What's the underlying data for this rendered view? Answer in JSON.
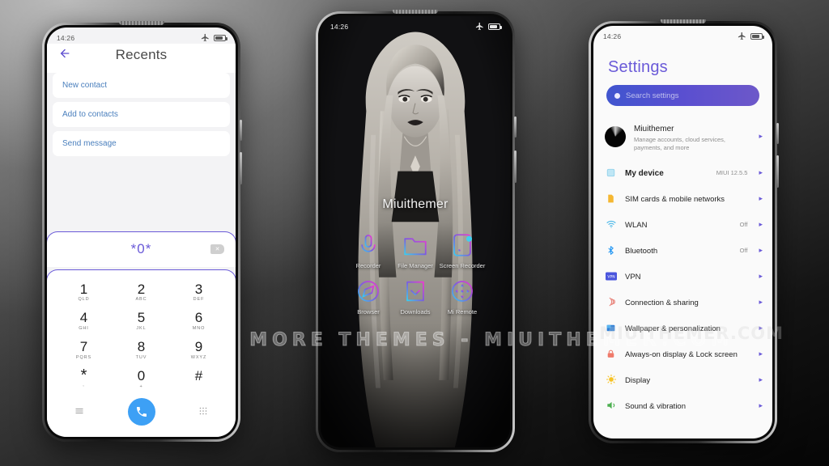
{
  "background": {
    "gradient_from": "#8e8e8e",
    "gradient_to": "#050505"
  },
  "watermark": {
    "main": "VISIT  FOR  MORE  THEMES  -  MIUITHEMER.COM",
    "overlay": "MIUITHEMER.COM"
  },
  "phones": {
    "dialer": {
      "status": {
        "time": "14:26",
        "airplane_icon": "airplane-icon",
        "battery_icon": "battery-icon"
      },
      "header": {
        "back_icon": "back-arrow-icon",
        "title": "Recents"
      },
      "menu": [
        {
          "label": "New contact"
        },
        {
          "label": "Add to contacts"
        },
        {
          "label": "Send message"
        }
      ],
      "number_field": {
        "value": "*0*",
        "backspace_icon": "backspace-icon"
      },
      "keys": [
        {
          "digit": "1",
          "letters": "QLD"
        },
        {
          "digit": "2",
          "letters": "ABC"
        },
        {
          "digit": "3",
          "letters": "DEF"
        },
        {
          "digit": "4",
          "letters": "GHI"
        },
        {
          "digit": "5",
          "letters": "JKL"
        },
        {
          "digit": "6",
          "letters": "MNO"
        },
        {
          "digit": "7",
          "letters": "PQRS"
        },
        {
          "digit": "8",
          "letters": "TUV"
        },
        {
          "digit": "9",
          "letters": "WXYZ"
        },
        {
          "digit": "*",
          "letters": ","
        },
        {
          "digit": "0",
          "letters": "+"
        },
        {
          "digit": "#",
          "letters": ""
        }
      ],
      "bottom": {
        "list_icon": "list-icon",
        "call_icon": "call-icon",
        "keypad_icon": "keypad-icon",
        "call_button_color": "#3da0f5"
      },
      "accent_color": "#6a5ad8",
      "link_color": "#4a7fbd"
    },
    "home": {
      "status": {
        "time": "14:26",
        "airplane_icon": "airplane-icon",
        "battery_icon": "battery-icon"
      },
      "title": "Miuithemer",
      "apps": [
        {
          "label": "Recorder",
          "icon": "microphone-icon"
        },
        {
          "label": "File Manager",
          "icon": "folder-icon"
        },
        {
          "label": "Screen Recorder",
          "icon": "screen-recorder-icon"
        },
        {
          "label": "Browser",
          "icon": "compass-icon"
        },
        {
          "label": "Downloads",
          "icon": "download-icon"
        },
        {
          "label": "Mi Remote",
          "icon": "remote-icon"
        }
      ],
      "icon_gradient": {
        "from": "#3fd0f0",
        "to": "#e33ad0"
      }
    },
    "settings": {
      "status": {
        "time": "14:26",
        "airplane_icon": "airplane-icon",
        "battery_icon": "battery-icon"
      },
      "title": "Settings",
      "search": {
        "placeholder": "Search settings",
        "icon": "search-icon",
        "gradient_from": "#4055cf",
        "gradient_to": "#6d58c9"
      },
      "account": {
        "name": "Miuithemer",
        "subtitle": "Manage accounts, cloud services, payments, and more",
        "avatar": "avatar",
        "arrow": "chevron-right-icon"
      },
      "items": [
        {
          "label": "My device",
          "value": "MIUI 12.5.5",
          "icon": "device-icon",
          "color": "#a8dcf0",
          "bold": true
        },
        {
          "label": "SIM cards & mobile networks",
          "value": "",
          "icon": "sim-card-icon",
          "color": "#f5b731"
        },
        {
          "label": "WLAN",
          "value": "Off",
          "icon": "wifi-icon",
          "color": "#4cb8e8"
        },
        {
          "label": "Bluetooth",
          "value": "Off",
          "icon": "bluetooth-icon",
          "color": "#2196f3"
        },
        {
          "label": "VPN",
          "value": "",
          "icon": "vpn-icon",
          "color": "#4a55dd"
        },
        {
          "label": "Connection & sharing",
          "value": "",
          "icon": "connection-sharing-icon",
          "color": "#e8837a"
        },
        {
          "label": "Wallpaper & personalization",
          "value": "",
          "icon": "wallpaper-icon",
          "color": "#3f8fe0"
        },
        {
          "label": "Always-on display & Lock screen",
          "value": "",
          "icon": "lock-icon",
          "color": "#ef7a6a"
        },
        {
          "label": "Display",
          "value": "",
          "icon": "brightness-icon",
          "color": "#f7c325"
        },
        {
          "label": "Sound & vibration",
          "value": "",
          "icon": "speaker-icon",
          "color": "#4caf50"
        }
      ],
      "accent_color": "#6a5ad8"
    }
  }
}
